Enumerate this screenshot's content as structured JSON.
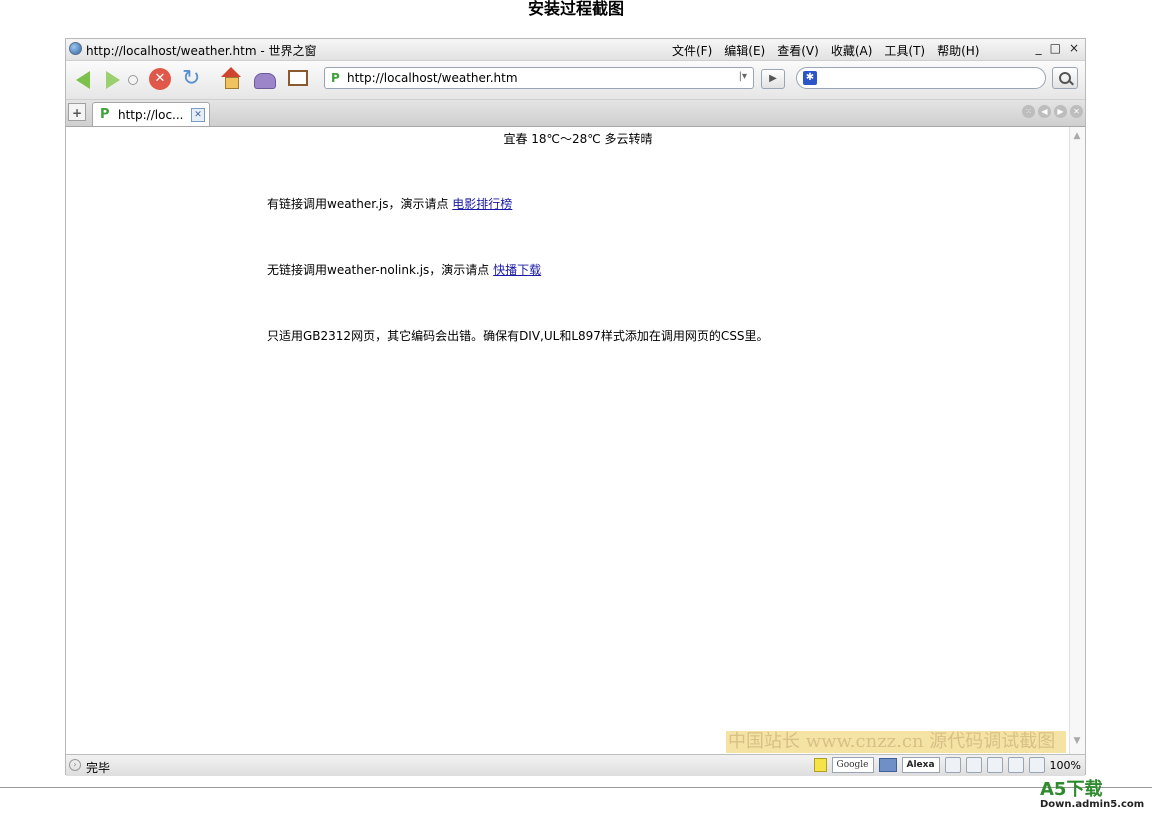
{
  "document": {
    "heading": "安装过程截图"
  },
  "window": {
    "title": "http://localhost/weather.htm - 世界之窗",
    "controls": [
      "_",
      "□",
      "×"
    ]
  },
  "menu": {
    "items": [
      "文件(F)",
      "编辑(E)",
      "查看(V)",
      "收藏(A)",
      "工具(T)",
      "帮助(H)"
    ]
  },
  "toolbar": {
    "address_value": "http://localhost/weather.htm",
    "search_value": ""
  },
  "tabs": [
    {
      "label": "http://loc..."
    }
  ],
  "content": {
    "weather": "宜春  18℃～28℃ 多云转晴",
    "line1_text": "有链接调用weather.js，演示请点 ",
    "line1_link": "电影排行榜",
    "line2_text": "无链接调用weather-nolink.js，演示请点 ",
    "line2_link": "快播下载",
    "line3_text": "只适用GB2312网页，其它编码会出错。确保有DIV,UL和L897样式添加在调用网页的CSS里。",
    "watermark": "中国站长 www.cnzz.cn 源代码调试截图"
  },
  "statusbar": {
    "text": "完毕",
    "google": "Google",
    "alexa": "Alexa",
    "zoom": "100%"
  },
  "branding": {
    "logo": "A5下载",
    "sub": "Down.admin5.com"
  }
}
